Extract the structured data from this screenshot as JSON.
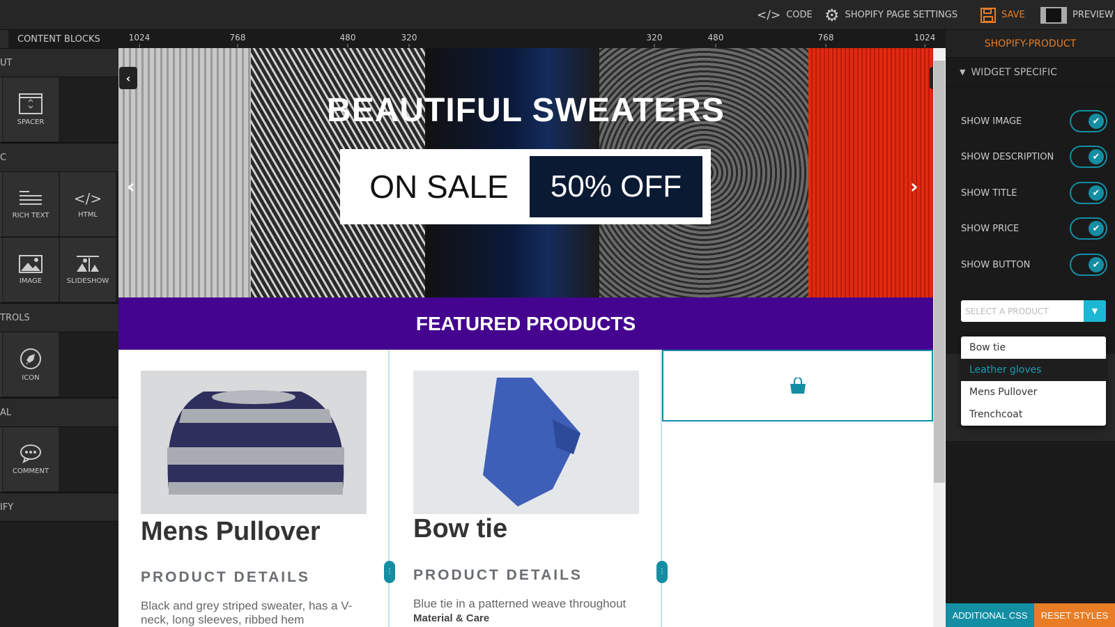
{
  "topbar": {
    "code": "CODE",
    "settings": "SHOPIFY PAGE SETTINGS",
    "save": "SAVE",
    "preview": "PREVIEW"
  },
  "sidebar": {
    "title": "CONTENT BLOCKS",
    "categories": [
      "UT",
      "C",
      "TROLS",
      "AL",
      "IFY"
    ],
    "blocks": {
      "spacer": "SPACER",
      "rich_text": "RICH TEXT",
      "html": "HTML",
      "image": "IMAGE",
      "slideshow": "SLIDESHOW",
      "icon": "ICON",
      "comment": "COMMENT"
    }
  },
  "ruler": [
    "1024",
    "768",
    "480",
    "320",
    "320",
    "480",
    "768",
    "1024"
  ],
  "banner": {
    "title": "BEAUTIFUL SWEATERS",
    "sale": "ON SALE",
    "discount": "50% OFF"
  },
  "featured": "FEATURED PRODUCTS",
  "products": [
    {
      "title": "Mens Pullover",
      "subtitle": "PRODUCT DETAILS",
      "description": "Black and grey striped sweater, has a V-neck, long sleeves, ribbed hem"
    },
    {
      "title": "Bow tie",
      "subtitle": "PRODUCT DETAILS",
      "description": "Blue tie in a patterned weave throughout",
      "extra": "Material & Care"
    }
  ],
  "panel": {
    "title": "SHOPIFY-PRODUCT",
    "section": "WIDGET SPECIFIC",
    "toggles": [
      {
        "label": "SHOW IMAGE",
        "on": true
      },
      {
        "label": "SHOW DESCRIPTION",
        "on": true
      },
      {
        "label": "SHOW TITLE",
        "on": true
      },
      {
        "label": "SHOW PRICE",
        "on": true
      },
      {
        "label": "SHOW BUTTON",
        "on": true
      }
    ],
    "select_placeholder": "SELECT A PRODUCT",
    "options": [
      "Bow tie",
      "Leather gloves",
      "Mens Pullover",
      "Trenchcoat"
    ],
    "highlighted_option": "Leather gloves",
    "additional_css": "ADDITIONAL CSS",
    "reset_styles": "RESET STYLES"
  },
  "colors": {
    "accent": "#138ea3",
    "orange": "#e87d26",
    "featured_bg": "#44048f"
  }
}
